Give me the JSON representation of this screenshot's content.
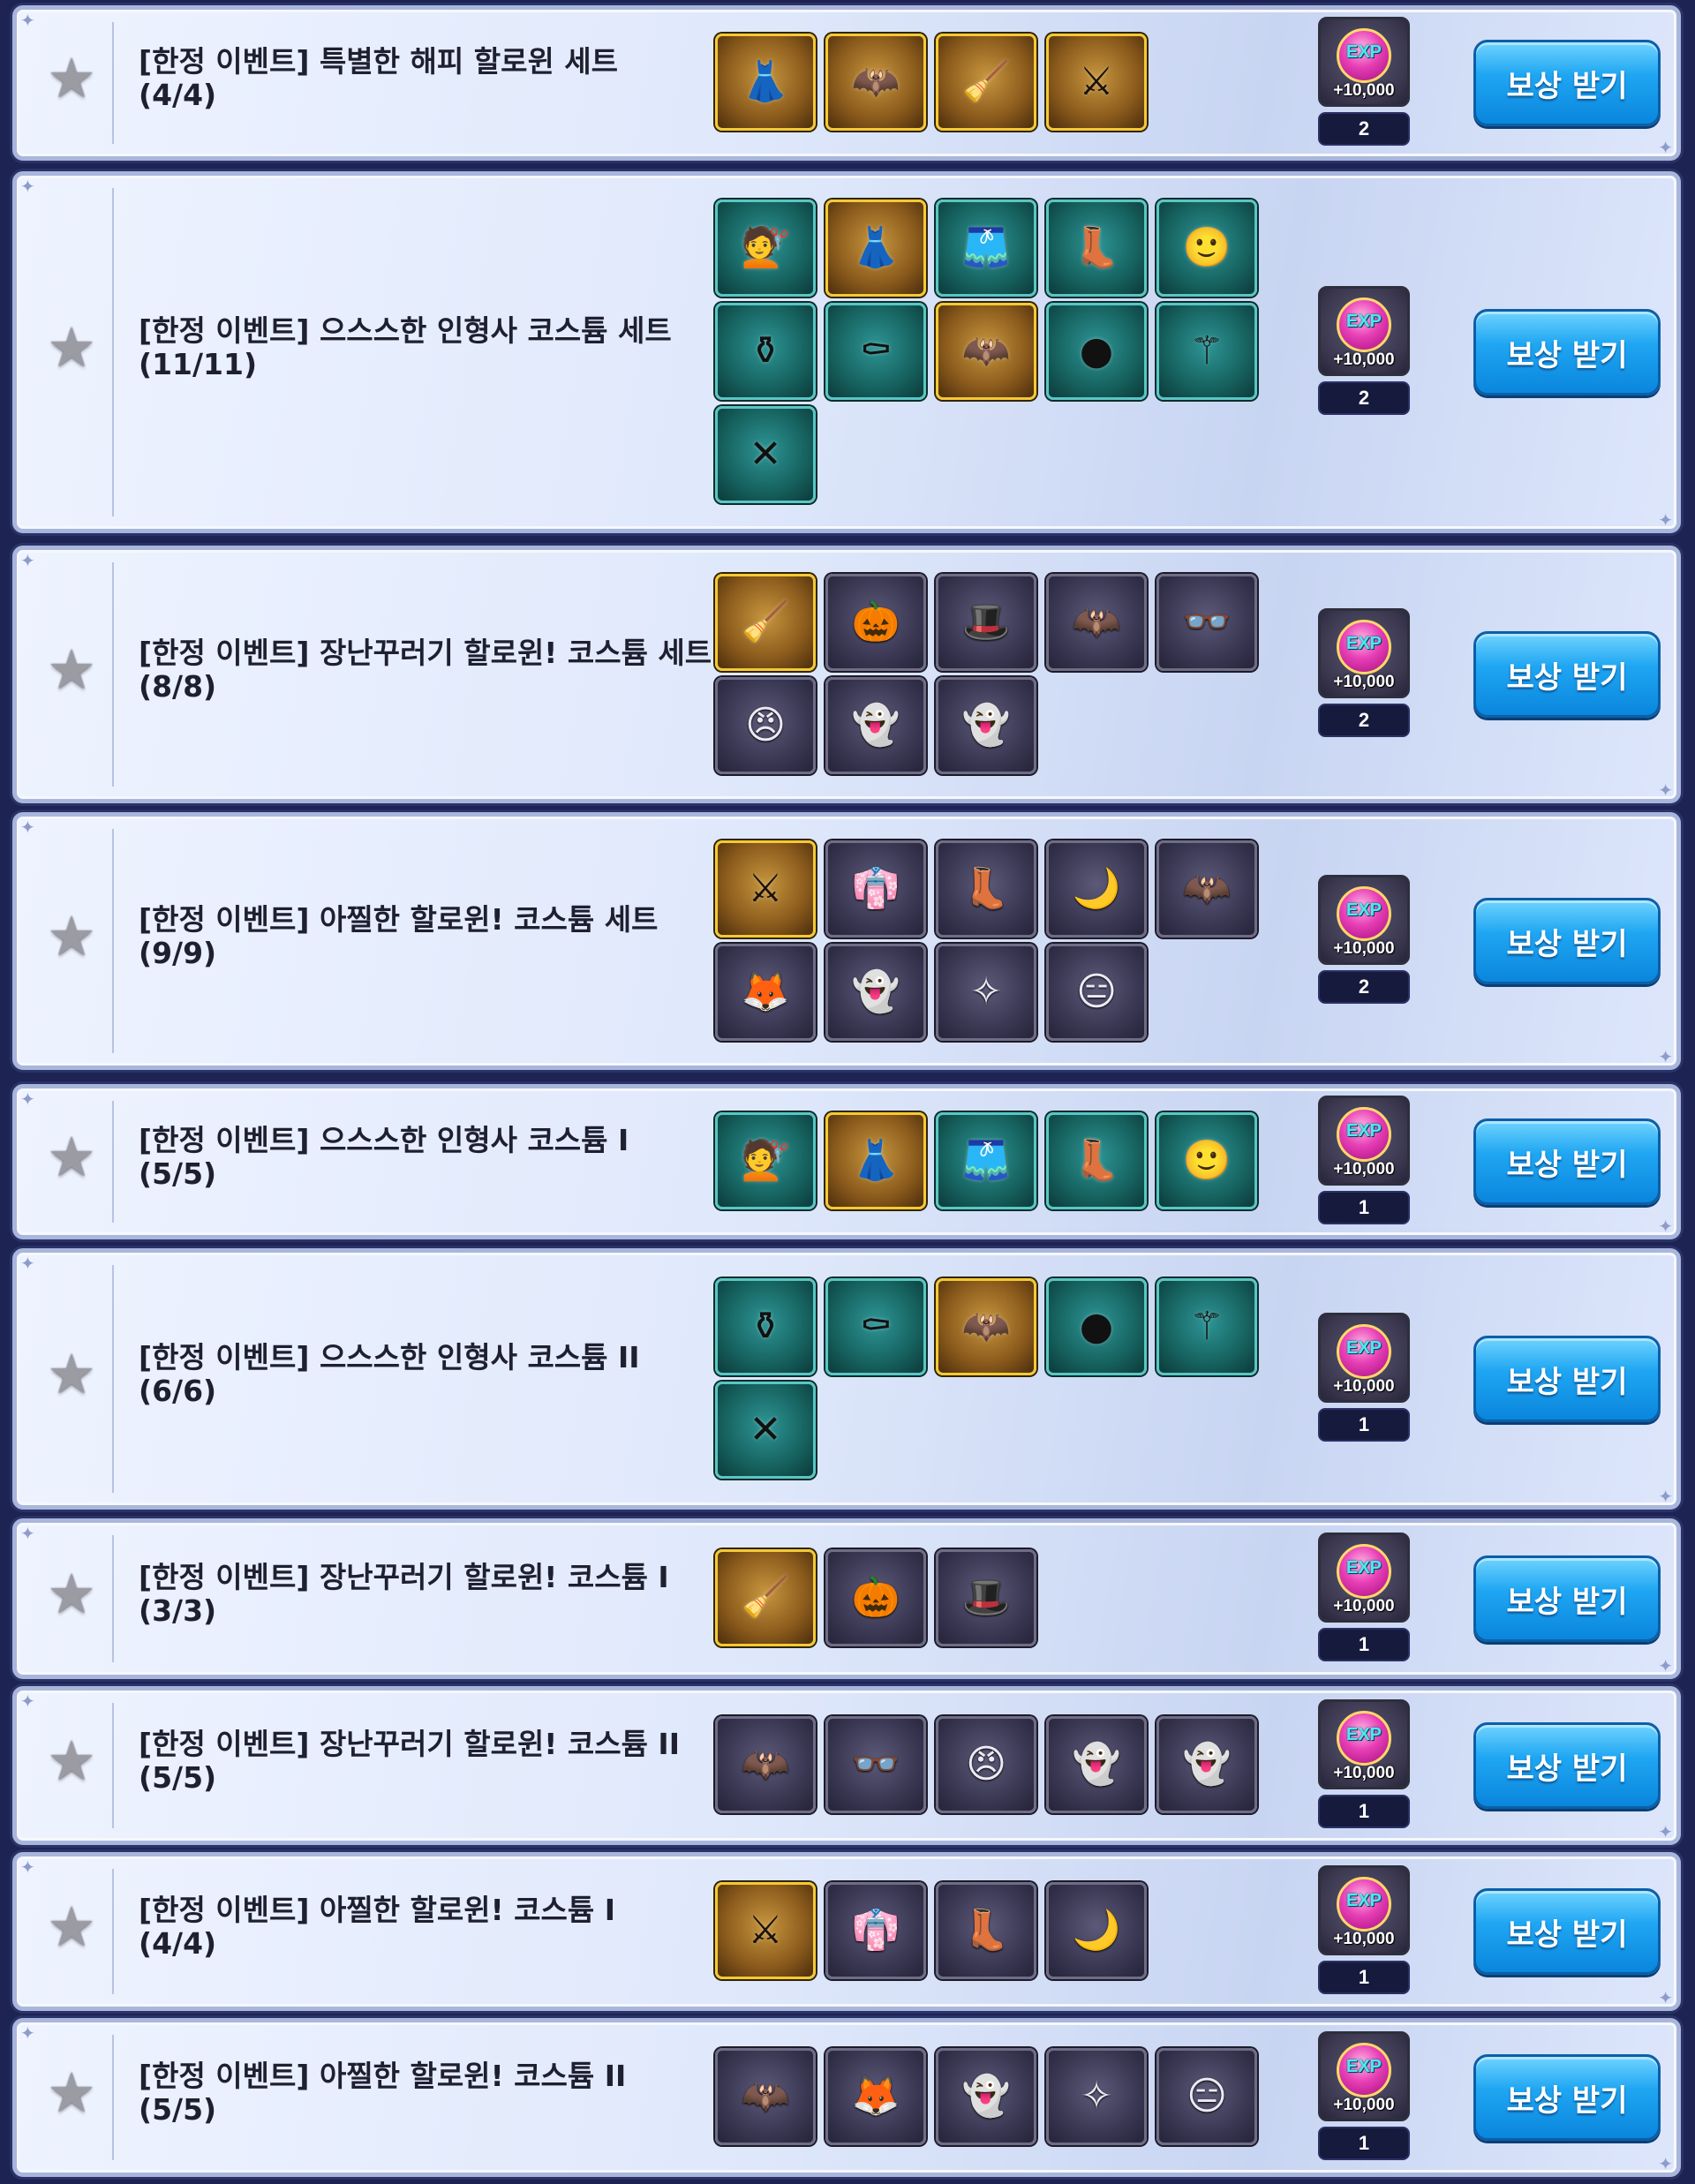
{
  "colors": {
    "row_border": "#a9b6dc",
    "button_blue": "#0a86dd",
    "item_gold_border": "#f5c934",
    "item_teal_border": "#59c6c4",
    "item_purple_border": "#6f6d86",
    "star_grey": "#9b9ba3"
  },
  "claim_label": "보상 받기",
  "exp_label": "EXP",
  "exp_amount": "+10,000",
  "rows": [
    {
      "title": "[한정 이벤트] 특별한 해피 할로윈 세트",
      "progress": "(4/4)",
      "count": "2",
      "items": [
        {
          "icon": "witch-dress-icon",
          "glyph": "👗",
          "rarity": "gold"
        },
        {
          "icon": "bat-wings-icon",
          "glyph": "🦇",
          "rarity": "gold"
        },
        {
          "icon": "broom-icon",
          "glyph": "🧹",
          "rarity": "gold"
        },
        {
          "icon": "scythe-icon",
          "glyph": "⚔",
          "rarity": "gold"
        }
      ]
    },
    {
      "title": "[한정 이벤트] 으스스한 인형사 코스튬 세트",
      "progress": "(11/11)",
      "count": "2",
      "items": [
        {
          "icon": "red-hair-icon",
          "glyph": "💇",
          "rarity": "teal"
        },
        {
          "icon": "dress-icon",
          "glyph": "👗",
          "rarity": "gold"
        },
        {
          "icon": "skirt-icon",
          "glyph": "🩳",
          "rarity": "teal"
        },
        {
          "icon": "boots-icon",
          "glyph": "👢",
          "rarity": "teal"
        },
        {
          "icon": "face-icon",
          "glyph": "🙂",
          "rarity": "teal"
        },
        {
          "icon": "coffin-pendant-icon",
          "glyph": "⚱",
          "rarity": "teal"
        },
        {
          "icon": "coffin-icon",
          "glyph": "⚰",
          "rarity": "teal"
        },
        {
          "icon": "bat-wings-icon",
          "glyph": "🦇",
          "rarity": "gold"
        },
        {
          "icon": "head-icon",
          "glyph": "●",
          "rarity": "teal"
        },
        {
          "icon": "staff-icon",
          "glyph": "⚚",
          "rarity": "teal"
        },
        {
          "icon": "stitch-accessory-icon",
          "glyph": "✕",
          "rarity": "teal"
        }
      ]
    },
    {
      "title": "[한정 이벤트] 장난꾸러기 할로윈! 코스튬 세트",
      "progress": "(8/8)",
      "count": "2",
      "items": [
        {
          "icon": "broom-icon",
          "glyph": "🧹",
          "rarity": "gold"
        },
        {
          "icon": "pumpkin-basket-icon",
          "glyph": "🎃",
          "rarity": "purple"
        },
        {
          "icon": "witch-hat-icon",
          "glyph": "🎩",
          "rarity": "purple"
        },
        {
          "icon": "bat-hat-icon",
          "glyph": "🦇",
          "rarity": "purple"
        },
        {
          "icon": "glasses-face-icon",
          "glyph": "👓",
          "rarity": "purple"
        },
        {
          "icon": "angry-face-icon",
          "glyph": "😠",
          "rarity": "purple"
        },
        {
          "icon": "ghost-necklace-icon",
          "glyph": "👻",
          "rarity": "purple"
        },
        {
          "icon": "ghost-earrings-icon",
          "glyph": "👻",
          "rarity": "purple"
        }
      ]
    },
    {
      "title": "[한정 이벤트] 아찔한 할로윈! 코스튬 세트",
      "progress": "(9/9)",
      "count": "2",
      "items": [
        {
          "icon": "scythe-icon",
          "glyph": "⚔",
          "rarity": "gold"
        },
        {
          "icon": "outfit-icon",
          "glyph": "👘",
          "rarity": "purple"
        },
        {
          "icon": "boots-icon",
          "glyph": "👢",
          "rarity": "purple"
        },
        {
          "icon": "horns-icon",
          "glyph": "🌙",
          "rarity": "purple"
        },
        {
          "icon": "bat-wings-icon",
          "glyph": "🦇",
          "rarity": "purple"
        },
        {
          "icon": "fox-mask-icon",
          "glyph": "🦊",
          "rarity": "purple"
        },
        {
          "icon": "ghost-necklace-icon",
          "glyph": "👻",
          "rarity": "purple"
        },
        {
          "icon": "earrings-icon",
          "glyph": "✧",
          "rarity": "purple"
        },
        {
          "icon": "bald-face-icon",
          "glyph": "😑",
          "rarity": "purple"
        }
      ]
    },
    {
      "title": "[한정 이벤트] 으스스한 인형사 코스튬 I",
      "progress": "(5/5)",
      "count": "1",
      "items": [
        {
          "icon": "red-hair-icon",
          "glyph": "💇",
          "rarity": "teal"
        },
        {
          "icon": "dress-icon",
          "glyph": "👗",
          "rarity": "gold"
        },
        {
          "icon": "skirt-icon",
          "glyph": "🩳",
          "rarity": "teal"
        },
        {
          "icon": "boots-icon",
          "glyph": "👢",
          "rarity": "teal"
        },
        {
          "icon": "face-icon",
          "glyph": "🙂",
          "rarity": "teal"
        }
      ]
    },
    {
      "title": "[한정 이벤트] 으스스한 인형사 코스튬 II",
      "progress": "(6/6)",
      "count": "1",
      "items": [
        {
          "icon": "coffin-pendant-icon",
          "glyph": "⚱",
          "rarity": "teal"
        },
        {
          "icon": "coffin-icon",
          "glyph": "⚰",
          "rarity": "teal"
        },
        {
          "icon": "bat-wings-icon",
          "glyph": "🦇",
          "rarity": "gold"
        },
        {
          "icon": "head-icon",
          "glyph": "●",
          "rarity": "teal"
        },
        {
          "icon": "staff-icon",
          "glyph": "⚚",
          "rarity": "teal"
        },
        {
          "icon": "stitch-accessory-icon",
          "glyph": "✕",
          "rarity": "teal"
        }
      ]
    },
    {
      "title": "[한정 이벤트] 장난꾸러기 할로윈! 코스튬 I",
      "progress": "(3/3)",
      "count": "1",
      "items": [
        {
          "icon": "broom-icon",
          "glyph": "🧹",
          "rarity": "gold"
        },
        {
          "icon": "pumpkin-basket-icon",
          "glyph": "🎃",
          "rarity": "purple"
        },
        {
          "icon": "witch-hat-icon",
          "glyph": "🎩",
          "rarity": "purple"
        }
      ]
    },
    {
      "title": "[한정 이벤트] 장난꾸러기 할로윈! 코스튬 II",
      "progress": "(5/5)",
      "count": "1",
      "items": [
        {
          "icon": "bat-hat-icon",
          "glyph": "🦇",
          "rarity": "purple"
        },
        {
          "icon": "glasses-face-icon",
          "glyph": "👓",
          "rarity": "purple"
        },
        {
          "icon": "angry-face-icon",
          "glyph": "😠",
          "rarity": "purple"
        },
        {
          "icon": "ghost-necklace-icon",
          "glyph": "👻",
          "rarity": "purple"
        },
        {
          "icon": "ghost-earrings-icon",
          "glyph": "👻",
          "rarity": "purple"
        }
      ]
    },
    {
      "title": "[한정 이벤트] 아찔한 할로윈! 코스튬 I",
      "progress": "(4/4)",
      "count": "1",
      "items": [
        {
          "icon": "scythe-icon",
          "glyph": "⚔",
          "rarity": "gold"
        },
        {
          "icon": "outfit-icon",
          "glyph": "👘",
          "rarity": "purple"
        },
        {
          "icon": "boots-icon",
          "glyph": "👢",
          "rarity": "purple"
        },
        {
          "icon": "horns-icon",
          "glyph": "🌙",
          "rarity": "purple"
        }
      ]
    },
    {
      "title": "[한정 이벤트] 아찔한 할로윈! 코스튬 II",
      "progress": "(5/5)",
      "count": "1",
      "items": [
        {
          "icon": "bat-wings-icon",
          "glyph": "🦇",
          "rarity": "purple"
        },
        {
          "icon": "fox-mask-icon",
          "glyph": "🦊",
          "rarity": "purple"
        },
        {
          "icon": "ghost-necklace-icon",
          "glyph": "👻",
          "rarity": "purple"
        },
        {
          "icon": "earrings-icon",
          "glyph": "✧",
          "rarity": "purple"
        },
        {
          "icon": "bald-face-icon",
          "glyph": "😑",
          "rarity": "purple"
        }
      ]
    }
  ]
}
